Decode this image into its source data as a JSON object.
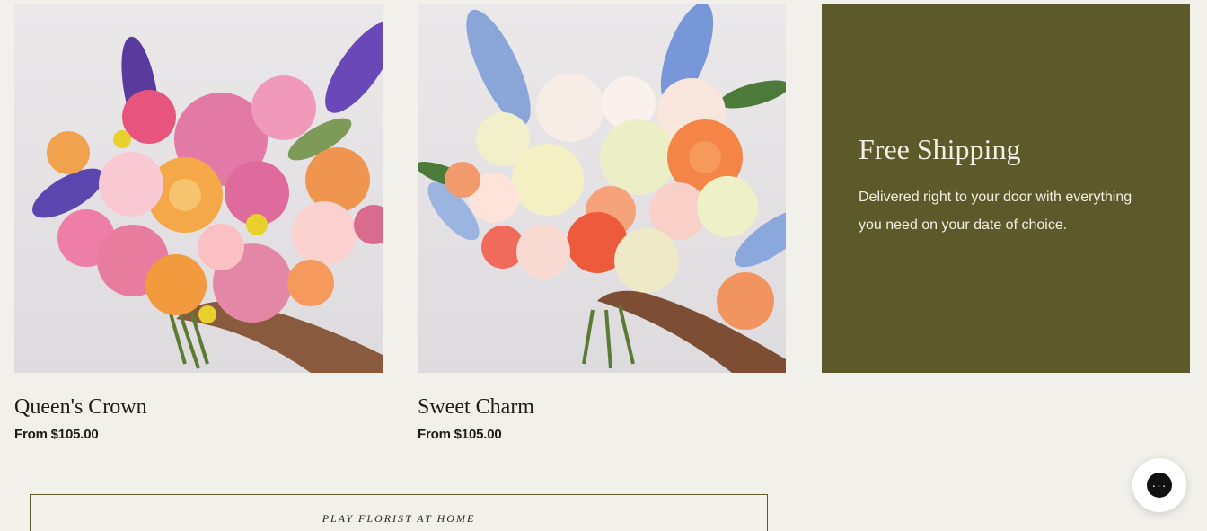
{
  "products": [
    {
      "title": "Queen's Crown",
      "price": "From $105.00",
      "image_icon": "bouquet-image-pink-purple"
    },
    {
      "title": "Sweet Charm",
      "price": "From $105.00",
      "image_icon": "bouquet-image-cream-orange"
    }
  ],
  "promo": {
    "title": "Free Shipping",
    "text": "Delivered right to your door with everything you need on your date of choice.",
    "bg_color": "#5c5a2b"
  },
  "banner": {
    "label": "PLAY FLORIST AT HOME"
  },
  "chat": {
    "icon": "chat-bubble-icon",
    "glyph": "···"
  }
}
